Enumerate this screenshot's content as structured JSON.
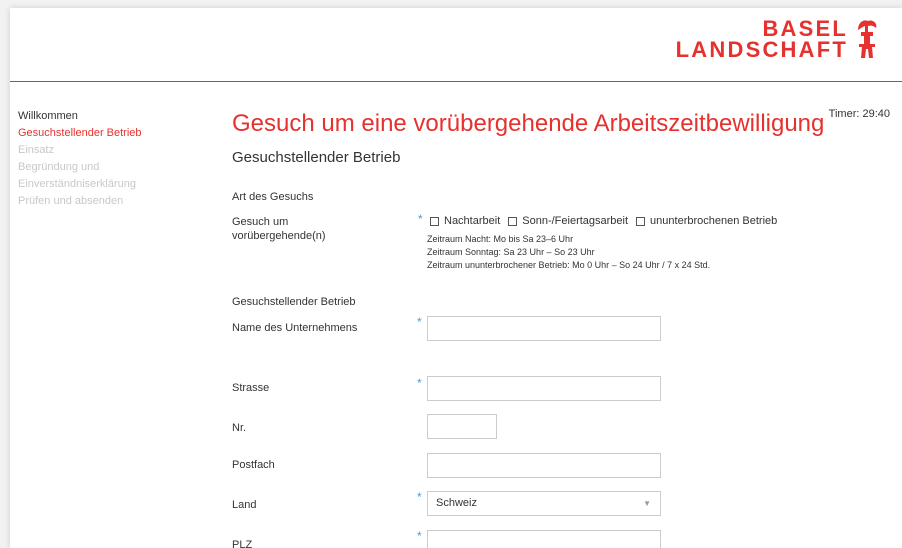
{
  "brand": {
    "line1": "BASEL",
    "line2": "LANDSCHAFT",
    "color": "#e5322f",
    "icon": "basel-staff-crest-icon"
  },
  "nav": {
    "items": [
      {
        "label": "Willkommen",
        "state": "done"
      },
      {
        "label": "Gesuchstellender Betrieb",
        "state": "active"
      },
      {
        "label": "Einsatz",
        "state": "disabled"
      },
      {
        "label": "Begründung und",
        "state": "disabled"
      },
      {
        "label": "Einverständniserklärung",
        "state": "disabled"
      },
      {
        "label": "Prüfen und absenden",
        "state": "disabled"
      }
    ]
  },
  "timer": "Timer: 29:40",
  "page_title": "Gesuch um eine vorübergehende Arbeitszeitbewilligung",
  "section_title": "Gesuchstellender Betrieb",
  "art": {
    "heading": "Art des Gesuchs",
    "label": "Gesuch um vorübergehende(n)",
    "required_marker": "*",
    "options": [
      {
        "label": "Nachtarbeit",
        "checked": false
      },
      {
        "label": "Sonn-/Feiertagsarbeit",
        "checked": false
      },
      {
        "label": "ununterbrochenen Betrieb",
        "checked": false
      }
    ],
    "info": [
      "Zeitraum Nacht: Mo bis Sa 23–6 Uhr",
      "Zeitraum Sonntag: Sa 23 Uhr – So 23 Uhr",
      "Zeitraum ununterbrochener Betrieb: Mo 0 Uhr – So 24 Uhr / 7 x 24 Std."
    ]
  },
  "betrieb": {
    "heading": "Gesuchstellender Betrieb",
    "name_label": "Name des Unternehmens",
    "name_value": "",
    "strasse_label": "Strasse",
    "strasse_value": "",
    "nr_label": "Nr.",
    "nr_value": "",
    "postfach_label": "Postfach",
    "postfach_value": "",
    "land_label": "Land",
    "land_value": "Schweiz",
    "plz_label": "PLZ",
    "plz_value": ""
  },
  "colors": {
    "accent": "#e5322f",
    "required": "#4f9bd0",
    "disabled_nav": "#c8c8c8"
  }
}
